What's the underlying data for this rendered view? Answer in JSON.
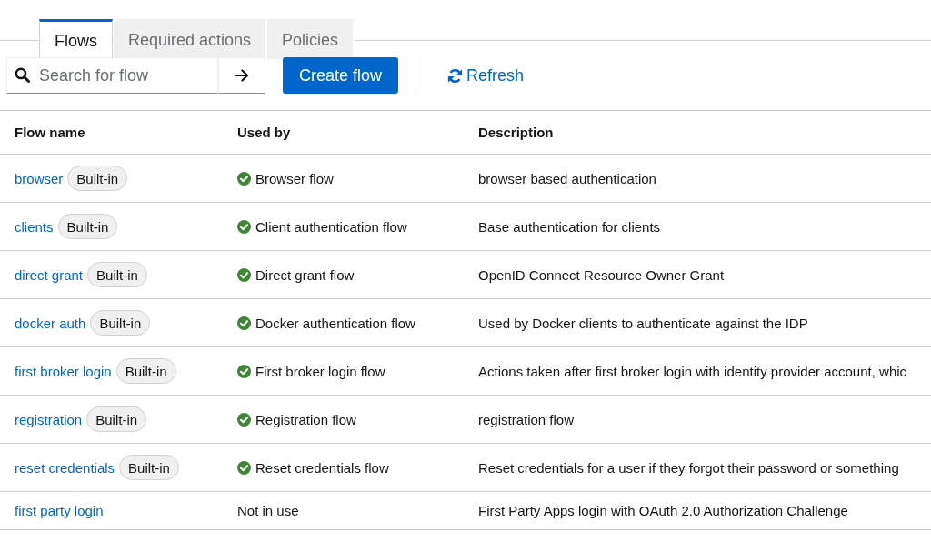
{
  "tabs": [
    {
      "label": "Flows",
      "selected": true
    },
    {
      "label": "Required actions",
      "selected": false
    },
    {
      "label": "Policies",
      "selected": false
    }
  ],
  "toolbar": {
    "search": {
      "placeholder": "Search for flow"
    },
    "create_button": "Create flow",
    "refresh_button": "Refresh"
  },
  "table": {
    "columns": [
      "Flow name",
      "Used by",
      "Description"
    ],
    "rows": [
      {
        "name": "browser",
        "tag": "Built-in",
        "in_use": true,
        "used_by": "Browser flow",
        "description": "browser based authentication"
      },
      {
        "name": "clients",
        "tag": "Built-in",
        "in_use": true,
        "used_by": "Client authentication flow",
        "description": "Base authentication for clients"
      },
      {
        "name": "direct grant",
        "tag": "Built-in",
        "in_use": true,
        "used_by": "Direct grant flow",
        "description": "OpenID Connect Resource Owner Grant"
      },
      {
        "name": "docker auth",
        "tag": "Built-in",
        "in_use": true,
        "used_by": "Docker authentication flow",
        "description": "Used by Docker clients to authenticate against the IDP"
      },
      {
        "name": "first broker login",
        "tag": "Built-in",
        "in_use": true,
        "used_by": "First broker login flow",
        "description": "Actions taken after first broker login with identity provider account, whic"
      },
      {
        "name": "registration",
        "tag": "Built-in",
        "in_use": true,
        "used_by": "Registration flow",
        "description": "registration flow"
      },
      {
        "name": "reset credentials",
        "tag": "Built-in",
        "in_use": true,
        "used_by": "Reset credentials flow",
        "description": "Reset credentials for a user if they forgot their password or something"
      },
      {
        "name": "first party login",
        "in_use": false,
        "used_by": "Not in use",
        "description": "First Party Apps login with OAuth 2.0 Authorization Challenge"
      }
    ]
  }
}
